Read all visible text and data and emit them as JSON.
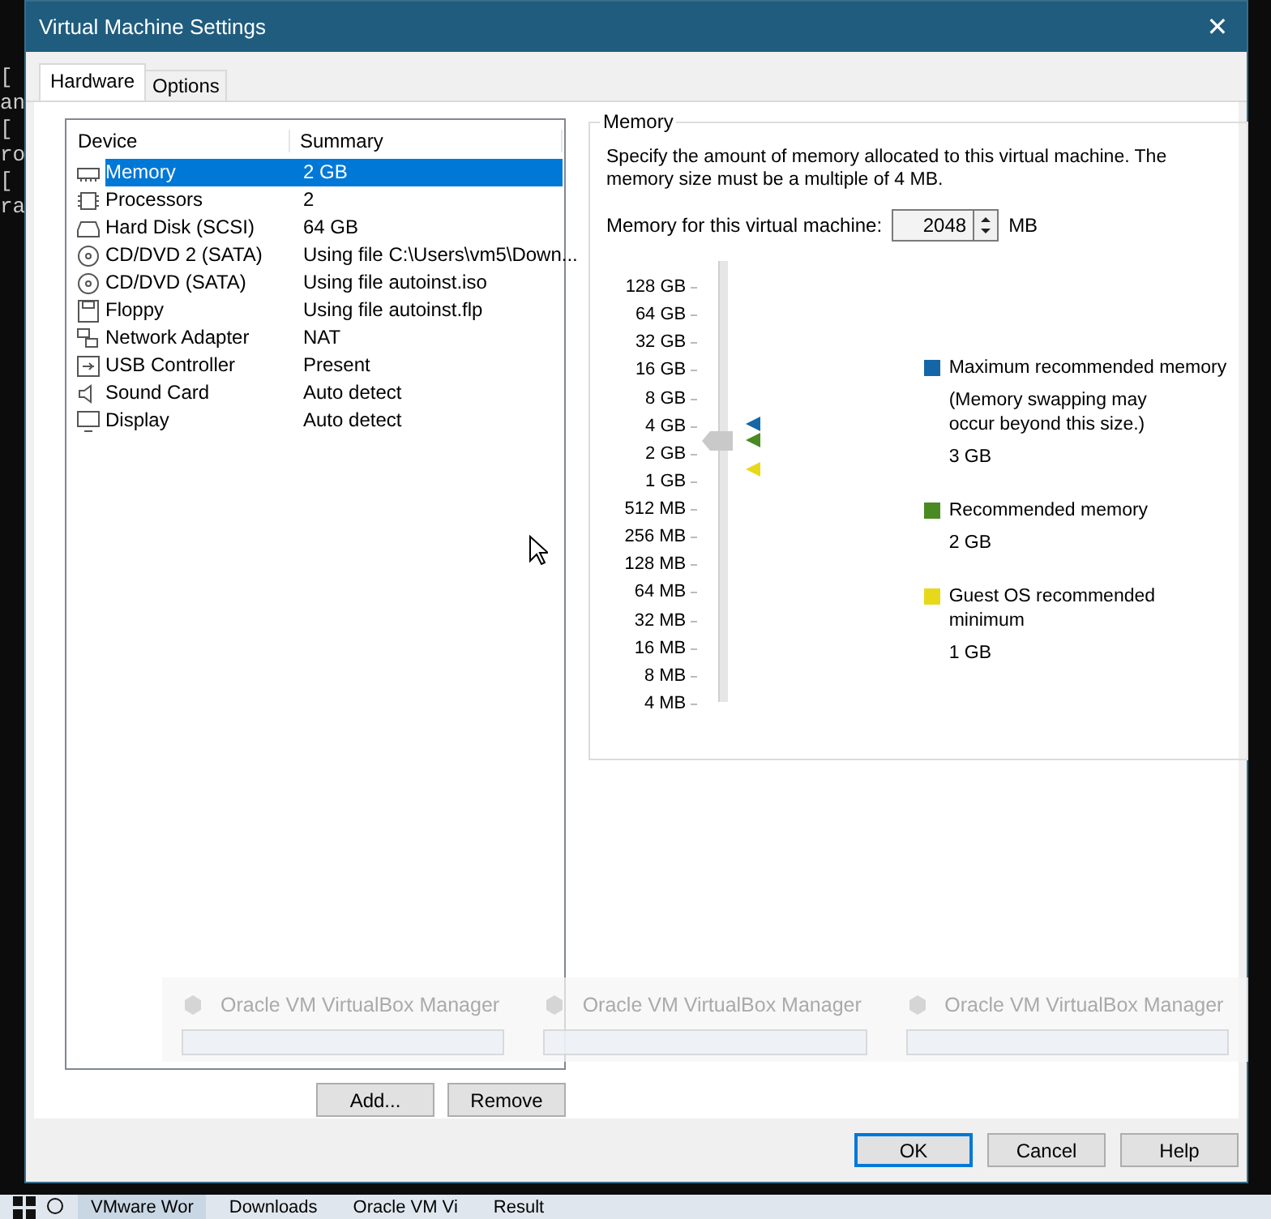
{
  "desktop": {
    "terminal_lines": [
      "[",
      "an",
      "[",
      "ro",
      "[",
      "ra"
    ]
  },
  "window": {
    "title": "Virtual Machine Settings",
    "close": "✕"
  },
  "tabs": [
    {
      "label": "Hardware",
      "selected": true
    },
    {
      "label": "Options",
      "selected": false
    }
  ],
  "devices": {
    "columns": [
      "Device",
      "Summary"
    ],
    "rows": [
      {
        "kind": "memory",
        "device": "Memory",
        "summary": "2 GB",
        "selected": true
      },
      {
        "kind": "cpu",
        "device": "Processors",
        "summary": "2",
        "selected": false
      },
      {
        "kind": "disk",
        "device": "Hard Disk (SCSI)",
        "summary": "64 GB",
        "selected": false
      },
      {
        "kind": "cd",
        "device": "CD/DVD 2 (SATA)",
        "summary": "Using file C:\\Users\\vm5\\Down...",
        "selected": false
      },
      {
        "kind": "cd",
        "device": "CD/DVD (SATA)",
        "summary": "Using file autoinst.iso",
        "selected": false
      },
      {
        "kind": "floppy",
        "device": "Floppy",
        "summary": "Using file autoinst.flp",
        "selected": false
      },
      {
        "kind": "network",
        "device": "Network Adapter",
        "summary": "NAT",
        "selected": false
      },
      {
        "kind": "usb",
        "device": "USB Controller",
        "summary": "Present",
        "selected": false
      },
      {
        "kind": "sound",
        "device": "Sound Card",
        "summary": "Auto detect",
        "selected": false
      },
      {
        "kind": "display",
        "device": "Display",
        "summary": "Auto detect",
        "selected": false
      }
    ]
  },
  "device_buttons": [
    "Add...",
    "Remove"
  ],
  "memory": {
    "group_title": "Memory",
    "description": "Specify the amount of memory allocated to this virtual machine. The memory size must be a multiple of 4 MB.",
    "field_label": "Memory for this virtual machine:",
    "value": "2048",
    "unit": "MB",
    "scale": [
      "128 GB",
      "64 GB",
      "32 GB",
      "16 GB",
      "8 GB",
      "4 GB",
      "2 GB",
      "1 GB",
      "512 MB",
      "256 MB",
      "128 MB",
      "64 MB",
      "32 MB",
      "16 MB",
      "8 MB",
      "4 MB"
    ],
    "level": 0.6,
    "markers": [
      {
        "color": "#1466a6",
        "level": 0.639
      },
      {
        "color": "#4a8a22",
        "level": 0.6
      },
      {
        "color": "#e8d81a",
        "level": 0.533
      }
    ],
    "legend": [
      {
        "color": "#1466a6",
        "title": "Maximum recommended memory",
        "note": "(Memory swapping may\noccur beyond this size.)",
        "value": "3 GB"
      },
      {
        "color": "#4a8a22",
        "title": "Recommended memory",
        "value": "2 GB"
      },
      {
        "color": "#e8d81a",
        "title": "Guest OS recommended minimum",
        "value": "1 GB"
      }
    ]
  },
  "dialog_buttons": [
    {
      "label": "OK",
      "default": true
    },
    {
      "label": "Cancel",
      "default": false
    },
    {
      "label": "Help",
      "default": false
    }
  ],
  "thumbnails": [
    {
      "title": "Oracle VM VirtualBox Manager"
    },
    {
      "title": "Oracle VM VirtualBox Manager"
    },
    {
      "title": "Oracle VM VirtualBox Manager"
    }
  ],
  "taskbar": {
    "items": [
      {
        "label": "VMware Wor",
        "active": true
      },
      {
        "label": "Downloads",
        "active": false
      },
      {
        "label": "Oracle VM Vi",
        "active": false
      },
      {
        "label": "Result",
        "active": false
      }
    ]
  }
}
